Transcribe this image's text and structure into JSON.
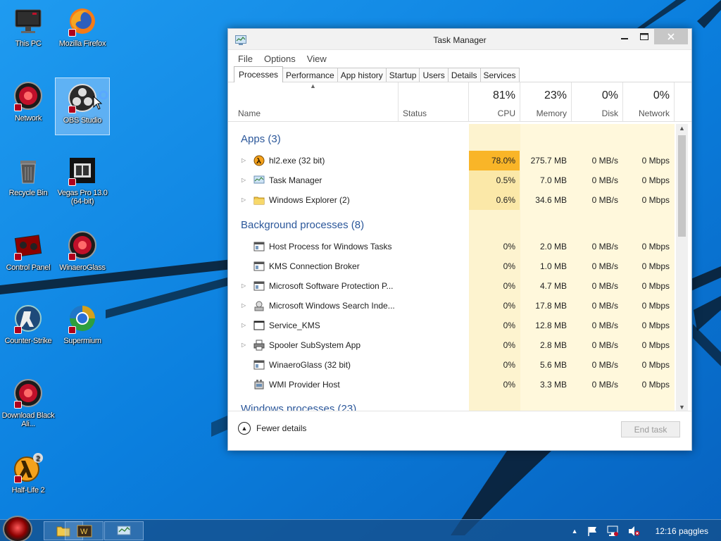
{
  "desktop": {
    "icons": [
      {
        "label": "This PC"
      },
      {
        "label": "Mozilla Firefox"
      },
      {
        "label": "Network"
      },
      {
        "label": "OBS Studio"
      },
      {
        "label": "Recycle Bin"
      },
      {
        "label": "Vegas Pro 13.0 (64-bit)"
      },
      {
        "label": "Control Panel"
      },
      {
        "label": "WinaeroGlass"
      },
      {
        "label": "Counter-Strike"
      },
      {
        "label": "Supermium"
      },
      {
        "label": "Download Black Ali..."
      },
      {
        "label": "Half-Life 2"
      }
    ]
  },
  "task_manager": {
    "title": "Task Manager",
    "menu": [
      "File",
      "Options",
      "View"
    ],
    "tabs": [
      "Processes",
      "Performance",
      "App history",
      "Startup",
      "Users",
      "Details",
      "Services"
    ],
    "active_tab": "Processes",
    "columns": {
      "name": "Name",
      "status": "Status",
      "cpu": {
        "pct": "81%",
        "label": "CPU"
      },
      "memory": {
        "pct": "23%",
        "label": "Memory"
      },
      "disk": {
        "pct": "0%",
        "label": "Disk"
      },
      "network": {
        "pct": "0%",
        "label": "Network"
      }
    },
    "groups": {
      "apps": "Apps (3)",
      "background": "Background processes (8)",
      "windows": "Windows processes (23)"
    },
    "apps": [
      {
        "name": "hl2.exe (32 bit)",
        "cpu": "78.0%",
        "memory": "275.7 MB",
        "disk": "0 MB/s",
        "network": "0 Mbps",
        "icon": "halflife-icon"
      },
      {
        "name": "Task Manager",
        "cpu": "0.5%",
        "memory": "7.0 MB",
        "disk": "0 MB/s",
        "network": "0 Mbps",
        "icon": "task-manager-icon"
      },
      {
        "name": "Windows Explorer (2)",
        "cpu": "0.6%",
        "memory": "34.6 MB",
        "disk": "0 MB/s",
        "network": "0 Mbps",
        "icon": "folder-icon"
      }
    ],
    "background": [
      {
        "name": "Host Process for Windows Tasks",
        "cpu": "0%",
        "memory": "2.0 MB",
        "disk": "0 MB/s",
        "network": "0 Mbps",
        "icon": "app-window-icon"
      },
      {
        "name": "KMS Connection Broker",
        "cpu": "0%",
        "memory": "1.0 MB",
        "disk": "0 MB/s",
        "network": "0 Mbps",
        "icon": "app-window-icon"
      },
      {
        "name": "Microsoft Software Protection P...",
        "cpu": "0%",
        "memory": "4.7 MB",
        "disk": "0 MB/s",
        "network": "0 Mbps",
        "icon": "app-window-icon"
      },
      {
        "name": "Microsoft Windows Search Inde...",
        "cpu": "0%",
        "memory": "17.8 MB",
        "disk": "0 MB/s",
        "network": "0 Mbps",
        "icon": "search-indexer-icon"
      },
      {
        "name": "Service_KMS",
        "cpu": "0%",
        "memory": "12.8 MB",
        "disk": "0 MB/s",
        "network": "0 Mbps",
        "icon": "console-window-icon"
      },
      {
        "name": "Spooler SubSystem App",
        "cpu": "0%",
        "memory": "2.8 MB",
        "disk": "0 MB/s",
        "network": "0 Mbps",
        "icon": "printer-icon"
      },
      {
        "name": "WinaeroGlass (32 bit)",
        "cpu": "0%",
        "memory": "5.6 MB",
        "disk": "0 MB/s",
        "network": "0 Mbps",
        "icon": "app-window-icon"
      },
      {
        "name": "WMI Provider Host",
        "cpu": "0%",
        "memory": "3.3 MB",
        "disk": "0 MB/s",
        "network": "0 Mbps",
        "icon": "wmi-icon"
      }
    ],
    "footer": {
      "fewer_details": "Fewer details",
      "end_task": "End task"
    }
  },
  "taskbar": {
    "clock": "12:16 paggles"
  },
  "colors": {
    "accent_blue": "#2b579a",
    "cpu_hot": "#f9b528",
    "cpu_col": "#fdf3cf",
    "col_light": "#fff8dc"
  }
}
